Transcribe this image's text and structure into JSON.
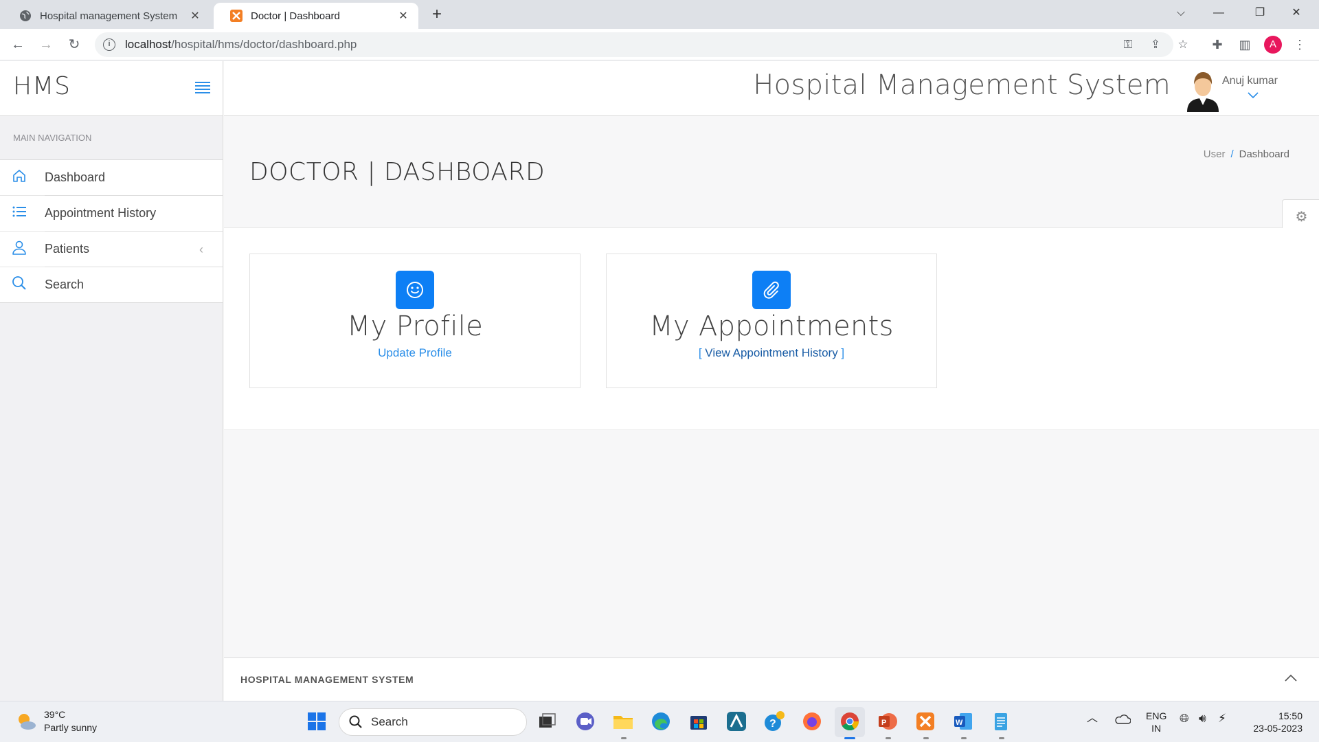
{
  "browser": {
    "tabs": [
      {
        "title": "Hospital management System",
        "active": false
      },
      {
        "title": "Doctor | Dashboard",
        "active": true
      }
    ],
    "url_host": "localhost",
    "url_path": "/hospital/hms/doctor/dashboard.php",
    "profile_initial": "A"
  },
  "sidebar": {
    "brand": "HMS",
    "nav_header": "Main Navigation",
    "items": [
      {
        "label": "Dashboard",
        "icon": "home-icon"
      },
      {
        "label": "Appointment History",
        "icon": "list-icon"
      },
      {
        "label": "Patients",
        "icon": "user-icon"
      },
      {
        "label": "Search",
        "icon": "search-icon"
      }
    ]
  },
  "header": {
    "app_title": "Hospital Management System",
    "user_name": "Anuj kumar"
  },
  "page": {
    "title": "DOCTOR | DASHBOARD",
    "breadcrumb": [
      "User",
      "Dashboard"
    ]
  },
  "cards": [
    {
      "title": "My Profile",
      "link": "Update Profile",
      "icon": "smiley-icon"
    },
    {
      "title": "My Appointments",
      "link_open": "[ ",
      "link": "View Appointment History",
      "link_close": " ]",
      "icon": "paperclip-icon"
    }
  ],
  "footer": {
    "text": "HOSPITAL MANAGEMENT SYSTEM"
  },
  "taskbar": {
    "weather_temp": "39°C",
    "weather_desc": "Partly sunny",
    "search_placeholder": "Search",
    "lang_top": "ENG",
    "lang_bottom": "IN",
    "time": "15:50",
    "date": "23-05-2023"
  },
  "colors": {
    "accent": "#2a8ee8",
    "badge": "#0d7ff5"
  }
}
